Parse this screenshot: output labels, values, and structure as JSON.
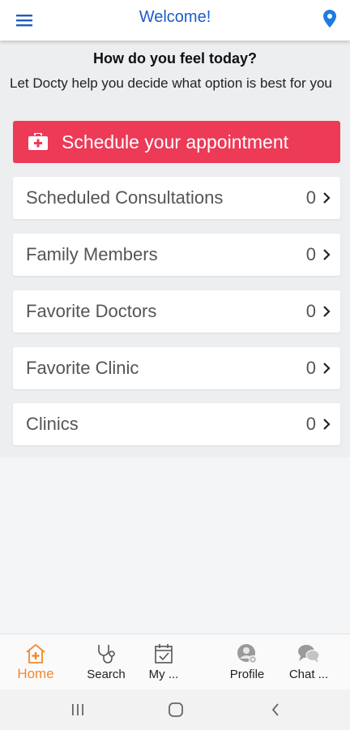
{
  "header": {
    "title": "Welcome!",
    "menu_icon": "menu-icon",
    "location_icon": "location-pin-icon"
  },
  "intro": {
    "heading": "How do you feel today?",
    "subtext": "Let Docty help you decide what option is best for you"
  },
  "cta": {
    "label": "Schedule your appointment",
    "icon": "medical-briefcase-icon",
    "color": "#ec3a57"
  },
  "rows": [
    {
      "label": "Scheduled Consultations",
      "count": "0"
    },
    {
      "label": "Family Members",
      "count": "0"
    },
    {
      "label": "Favorite Doctors",
      "count": "0"
    },
    {
      "label": "Favorite Clinic",
      "count": "0"
    },
    {
      "label": "Clinics",
      "count": "0"
    }
  ],
  "bottom_nav": [
    {
      "label": "Home",
      "icon": "home-medical-icon",
      "active": true
    },
    {
      "label": "Search",
      "icon": "stethoscope-icon",
      "active": false
    },
    {
      "label": "My ...",
      "icon": "calendar-check-icon",
      "active": false
    },
    {
      "label": "Profile",
      "icon": "profile-gear-icon",
      "active": false
    },
    {
      "label": "Chat ...",
      "icon": "chat-bubbles-icon",
      "active": false
    }
  ],
  "colors": {
    "accent_blue": "#1c5cc9",
    "active_orange": "#f08a2b"
  }
}
